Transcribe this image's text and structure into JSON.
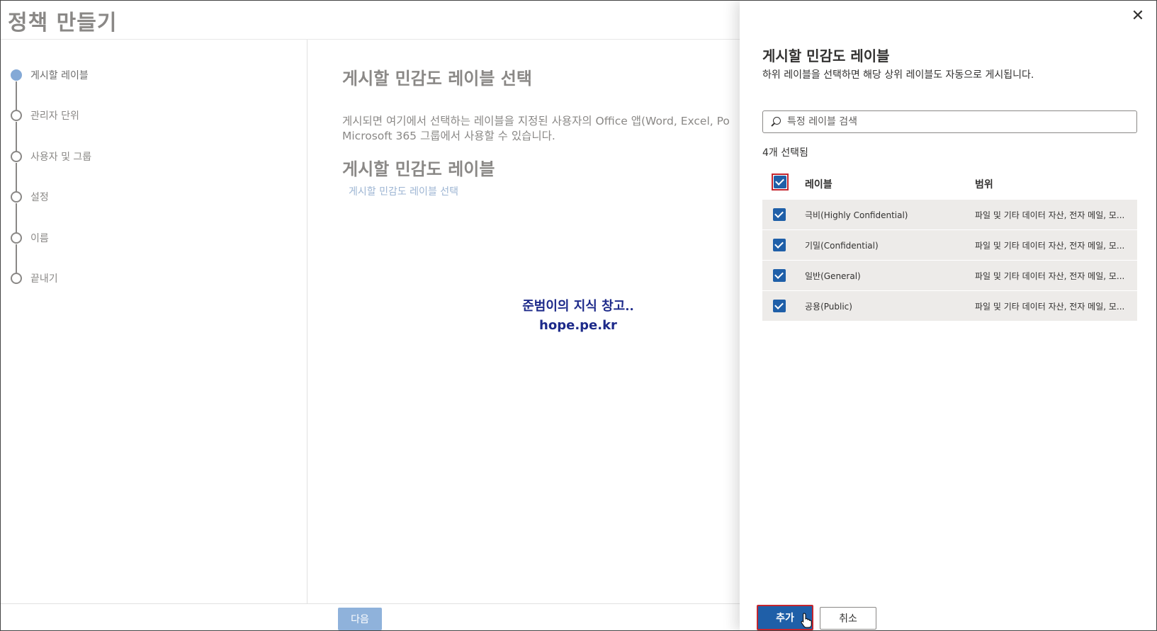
{
  "page": {
    "title": "정책 만들기"
  },
  "wizard": {
    "steps": [
      {
        "label": "게시할 레이블",
        "active": true
      },
      {
        "label": "관리자 단위",
        "active": false
      },
      {
        "label": "사용자 및 그룹",
        "active": false
      },
      {
        "label": "설정",
        "active": false
      },
      {
        "label": "이름",
        "active": false
      },
      {
        "label": "끝내기",
        "active": false
      }
    ]
  },
  "main": {
    "heading": "게시할 민감도 레이블 선택",
    "description_line1": "게시되면 여기에서 선택하는 레이블을 지정된 사용자의 Office 앱(Word, Excel, Po",
    "description_line2": "Microsoft 365 그룹에서 사용할 수 있습니다.",
    "subheading": "게시할 민감도 레이블",
    "select_link": "게시할 민감도 레이블 선택",
    "watermark_line1": "준범이의 지식 창고..",
    "watermark_line2": "hope.pe.kr"
  },
  "footer": {
    "next_label": "다음"
  },
  "panel": {
    "close_icon": "close-icon",
    "title": "게시할 민감도 레이블",
    "subtitle": "하위 레이블을 선택하면 해당 상위 레이블도 자동으로 게시됩니다.",
    "search_placeholder": "특정 레이블 검색",
    "selected_count": "4개 선택됨",
    "columns": {
      "label": "레이블",
      "scope": "범위"
    },
    "rows": [
      {
        "name": "극비(Highly Confidential)",
        "scope": "파일 및 기타 데이터 자산, 전자 메일, 모...",
        "checked": true
      },
      {
        "name": "기밀(Confidential)",
        "scope": "파일 및 기타 데이터 자산, 전자 메일, 모...",
        "checked": true
      },
      {
        "name": "일반(General)",
        "scope": "파일 및 기타 데이터 자산, 전자 메일, 모...",
        "checked": true
      },
      {
        "name": "공용(Public)",
        "scope": "파일 및 기타 데이터 자산, 전자 메일, 모...",
        "checked": true
      }
    ],
    "add_label": "추가",
    "cancel_label": "취소"
  },
  "colors": {
    "accent": "#1f5fa8",
    "highlight": "#c4262e",
    "row_bg": "#edebe9",
    "active_step": "#84a9d6"
  }
}
